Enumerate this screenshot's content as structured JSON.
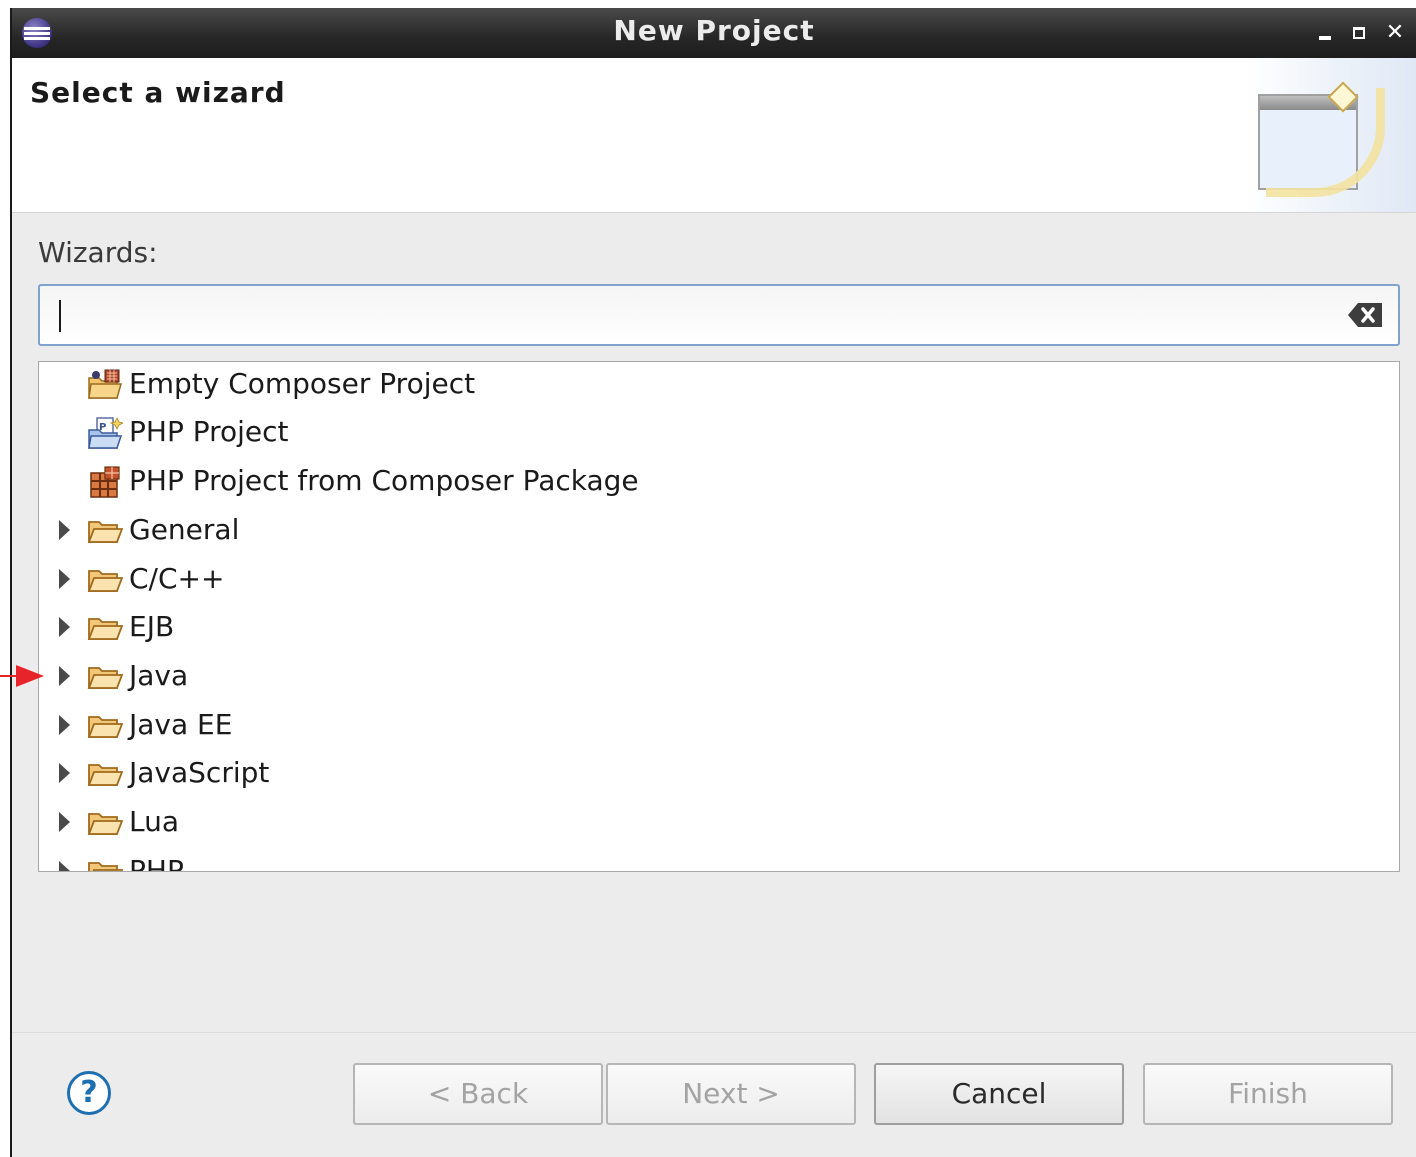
{
  "window": {
    "title": "New Project"
  },
  "banner": {
    "title": "Select a wizard"
  },
  "wizards": {
    "label": "Wizards:",
    "filter_value": "",
    "items": [
      {
        "label": "Empty Composer Project",
        "icon": "composer-project-icon",
        "expandable": false
      },
      {
        "label": "PHP Project",
        "icon": "php-project-icon",
        "expandable": false
      },
      {
        "label": "PHP Project from Composer Package",
        "icon": "composer-package-icon",
        "expandable": false
      },
      {
        "label": "General",
        "icon": "folder-icon",
        "expandable": true
      },
      {
        "label": "C/C++",
        "icon": "folder-icon",
        "expandable": true
      },
      {
        "label": "EJB",
        "icon": "folder-icon",
        "expandable": true
      },
      {
        "label": "Java",
        "icon": "folder-icon",
        "expandable": true
      },
      {
        "label": "Java EE",
        "icon": "folder-icon",
        "expandable": true
      },
      {
        "label": "JavaScript",
        "icon": "folder-icon",
        "expandable": true
      },
      {
        "label": "Lua",
        "icon": "folder-icon",
        "expandable": true
      },
      {
        "label": "PHP",
        "icon": "folder-icon",
        "expandable": true
      }
    ]
  },
  "buttons": {
    "help": "?",
    "back": "< Back",
    "next": "Next >",
    "cancel": "Cancel",
    "finish": "Finish"
  },
  "colors": {
    "accent": "#7ea3cf",
    "folder": "#e8b25a",
    "pointer_arrow": "#e8242b"
  }
}
